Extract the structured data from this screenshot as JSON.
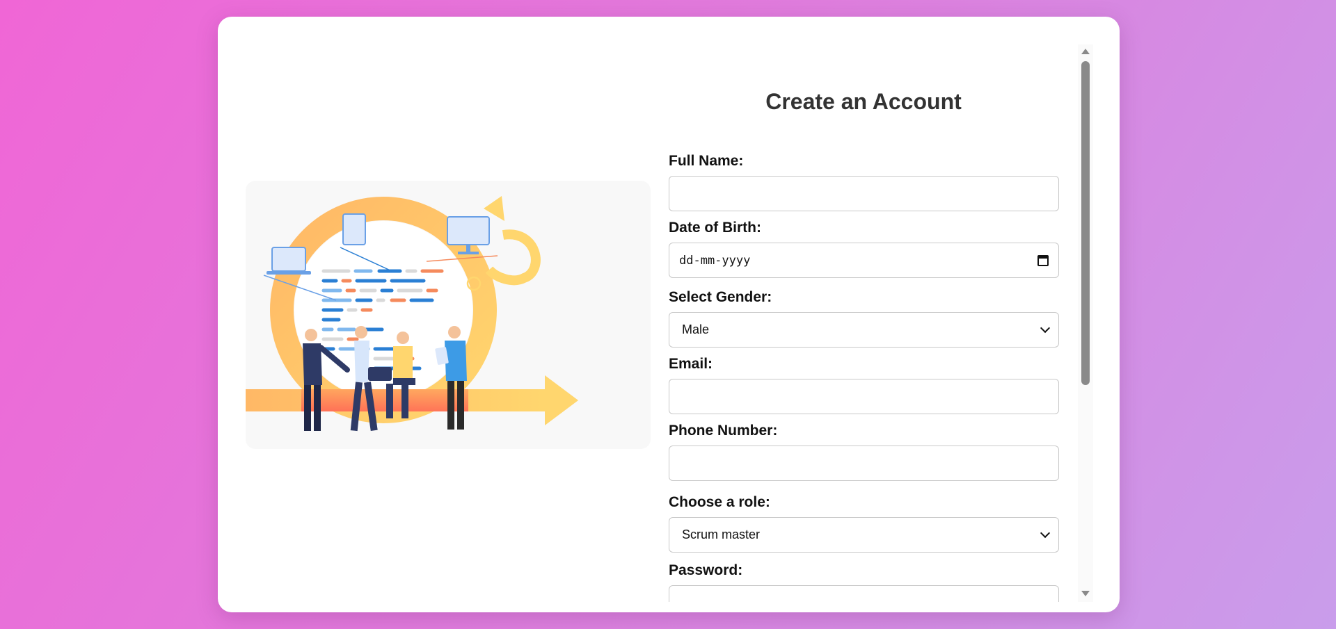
{
  "form": {
    "title": "Create an Account",
    "fields": {
      "full_name": {
        "label": "Full Name:",
        "value": ""
      },
      "dob": {
        "label": "Date of Birth:",
        "placeholder": "dd-mm-yyyy"
      },
      "gender": {
        "label": "Select Gender:",
        "selected": "Male"
      },
      "email": {
        "label": "Email:",
        "value": ""
      },
      "phone": {
        "label": "Phone Number:",
        "value": ""
      },
      "role": {
        "label": "Choose a role:",
        "selected": "Scrum master"
      },
      "password": {
        "label": "Password:",
        "value": ""
      }
    }
  },
  "illustration": {
    "icon": "agile-team-illustration"
  },
  "colors": {
    "background_start": "#f066d6",
    "background_end": "#c99deb",
    "card": "#ffffff",
    "cycle_orange": "#ffb866",
    "cycle_yellow": "#ffd66e",
    "code_blue": "#2a7fd4",
    "code_orange": "#f58a5c"
  }
}
